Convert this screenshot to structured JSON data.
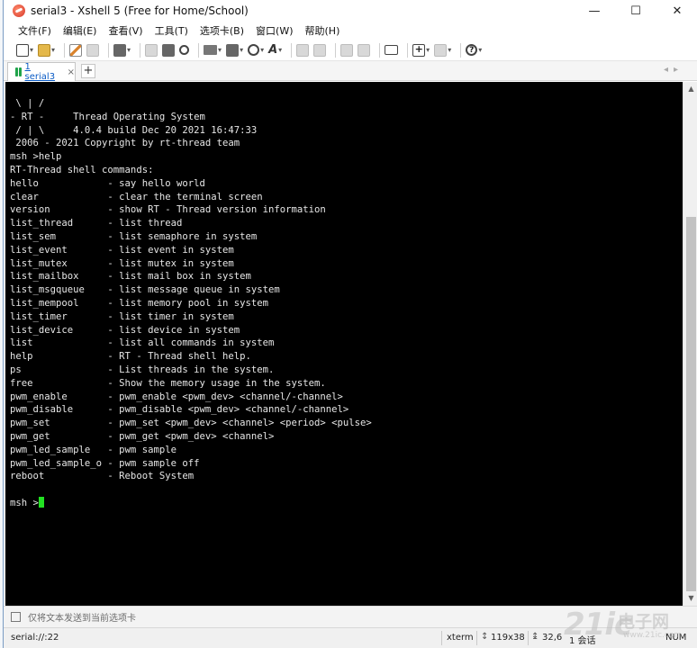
{
  "window": {
    "title": "serial3 - Xshell 5 (Free for Home/School)",
    "controls": {
      "minimize": "—",
      "maximize": "☐",
      "close": "✕"
    }
  },
  "menu": [
    "文件(F)",
    "编辑(E)",
    "查看(V)",
    "工具(T)",
    "选项卡(B)",
    "窗口(W)",
    "帮助(H)"
  ],
  "toolbar_icons": [
    "new-session-icon",
    "open-folder-icon",
    "pencil-icon",
    "reconnect-icon",
    "properties-icon",
    "copy-icon",
    "paste-icon",
    "find-icon",
    "print-icon",
    "transfer-icon",
    "globe-icon",
    "font-icon",
    "lock-icon",
    "compose-icon",
    "fullscreen-icon",
    "transparent-icon",
    "keyboard-icon",
    "new-tab-icon",
    "layout-icon",
    "help-icon"
  ],
  "tabs": [
    {
      "label": "1 serial3",
      "active": true,
      "status_color": "#1fa34a"
    }
  ],
  "tab_add": "+",
  "tab_nav": {
    "prev": "◂",
    "next": "▸"
  },
  "terminal": {
    "lines": [
      " \\ | /",
      "- RT -     Thread Operating System",
      " / | \\     4.0.4 build Dec 20 2021 16:47:33",
      " 2006 - 2021 Copyright by rt-thread team",
      "msh >help",
      "RT-Thread shell commands:",
      "hello            - say hello world",
      "clear            - clear the terminal screen",
      "version          - show RT - Thread version information",
      "list_thread      - list thread",
      "list_sem         - list semaphore in system",
      "list_event       - list event in system",
      "list_mutex       - list mutex in system",
      "list_mailbox     - list mail box in system",
      "list_msgqueue    - list message queue in system",
      "list_mempool     - list memory pool in system",
      "list_timer       - list timer in system",
      "list_device      - list device in system",
      "list             - list all commands in system",
      "help             - RT - Thread shell help.",
      "ps               - List threads in the system.",
      "free             - Show the memory usage in the system.",
      "pwm_enable       - pwm_enable <pwm_dev> <channel/-channel>",
      "pwm_disable      - pwm_disable <pwm_dev> <channel/-channel>",
      "pwm_set          - pwm_set <pwm_dev> <channel> <period> <pulse>",
      "pwm_get          - pwm_get <pwm_dev> <channel>",
      "pwm_led_sample   - pwm sample",
      "pwm_led_sample_o - pwm sample off",
      "reboot           - Reboot System",
      ""
    ],
    "prompt": "msh >",
    "cursor_color": "#22e022",
    "background": "#000000",
    "foreground": "#e6e6e6"
  },
  "send_bar": {
    "placeholder": "仅将文本发送到当前选项卡"
  },
  "status": {
    "connection": "serial://:22",
    "terminal_type": "xterm",
    "size": "119x38",
    "cursor_pos": "32,6",
    "sessions": "1 会话",
    "caps": "",
    "num": "NUM"
  },
  "watermark": {
    "logo": "21ic",
    "text": "电子网",
    "url": "www.21ic.com"
  }
}
